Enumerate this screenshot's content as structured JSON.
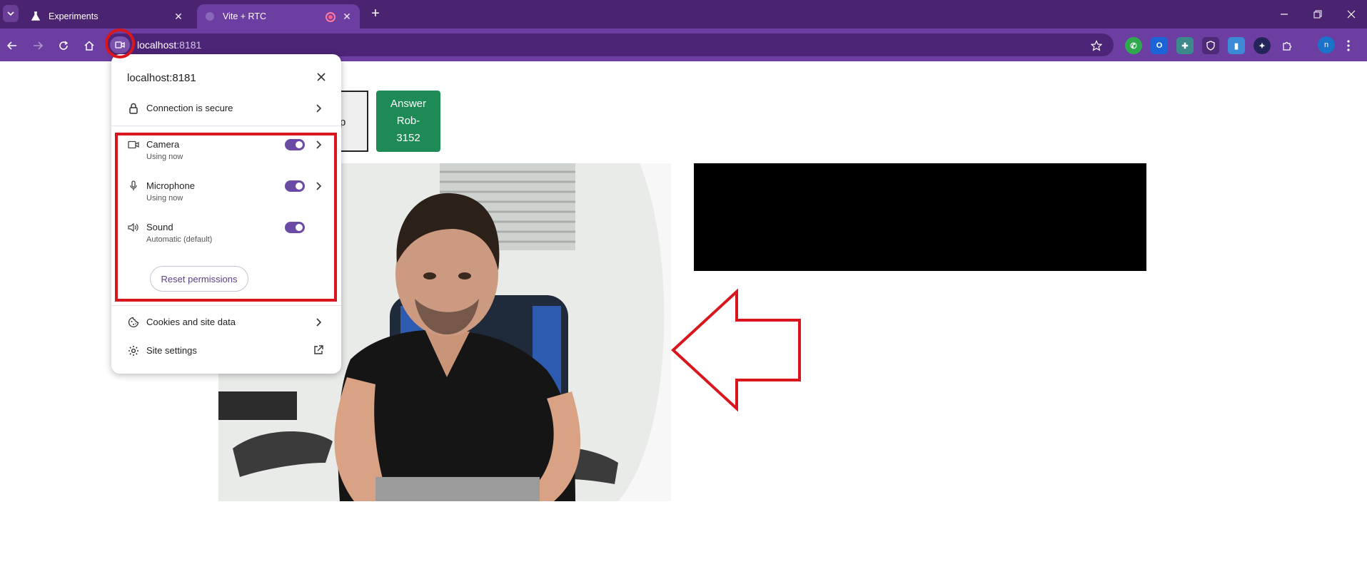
{
  "browser": {
    "tabs": [
      {
        "title": "Experiments",
        "active": false
      },
      {
        "title": "Vite + RTC",
        "active": true
      }
    ],
    "address": {
      "host": "localhost",
      "port": ":8181"
    }
  },
  "page": {
    "buttons": {
      "partial_label": "p",
      "answer_label": [
        "Answer",
        "Rob-",
        "3152"
      ]
    }
  },
  "popup": {
    "title": "localhost:8181",
    "connection_label": "Connection is secure",
    "permissions": [
      {
        "name": "Camera",
        "status": "Using now",
        "enabled": true
      },
      {
        "name": "Microphone",
        "status": "Using now",
        "enabled": true
      },
      {
        "name": "Sound",
        "status": "Automatic (default)",
        "enabled": true
      }
    ],
    "reset_label": "Reset permissions",
    "cookies_label": "Cookies and site data",
    "site_settings_label": "Site settings"
  },
  "colors": {
    "tabstrip": "#4a2470",
    "toolbar": "#6c3ea2",
    "answer_button": "#1e8a55",
    "annotation": "#d9161e",
    "toggle_on": "#6b4aa6"
  }
}
